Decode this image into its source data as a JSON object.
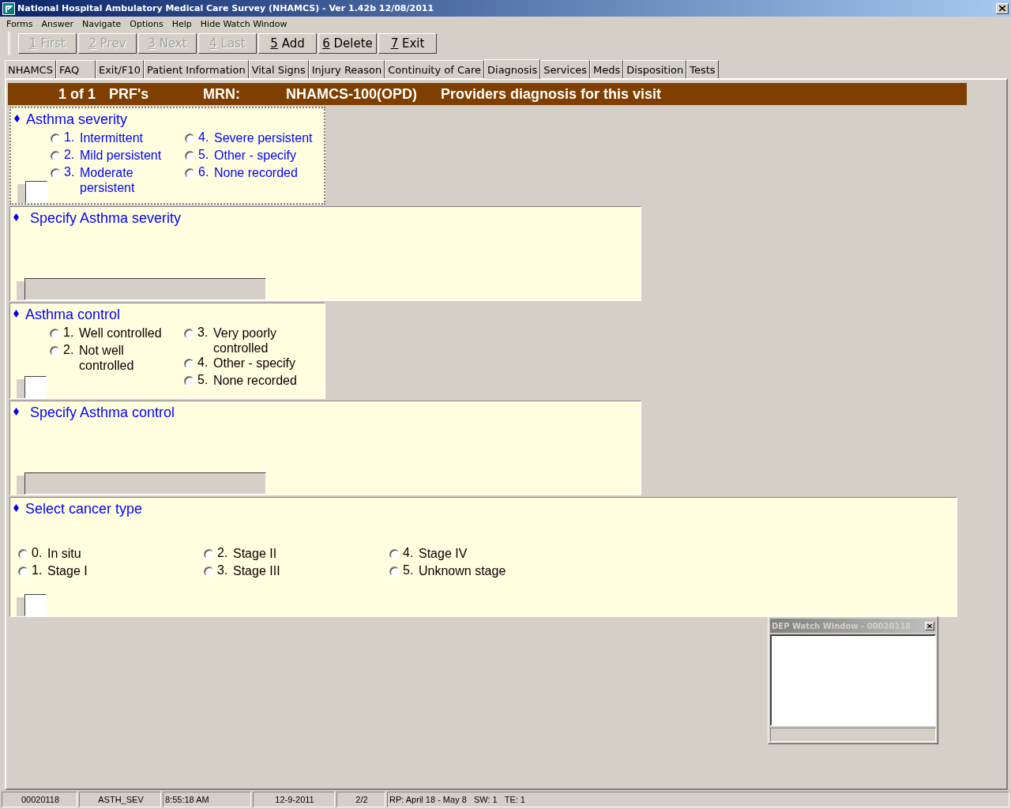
{
  "window": {
    "title": "National Hospital Ambulatory Medical Care Survey (NHAMCS) - Ver 1.42b 12/08/2011"
  },
  "menu": [
    "Forms",
    "Answer",
    "Navigate",
    "Options",
    "Help",
    "Hide Watch Window"
  ],
  "toolbar": [
    {
      "key": "1",
      "label": "First",
      "disabled": true
    },
    {
      "key": "2",
      "label": "Prev",
      "disabled": true
    },
    {
      "key": "3",
      "label": "Next",
      "disabled": true
    },
    {
      "key": "4",
      "label": "Last",
      "disabled": true
    },
    {
      "key": "5",
      "label": "Add",
      "disabled": false
    },
    {
      "key": "6",
      "label": "Delete",
      "disabled": false
    },
    {
      "key": "7",
      "label": "Exit",
      "disabled": false
    }
  ],
  "tabs": [
    {
      "label": "NHAMCS",
      "selected": false
    },
    {
      "label": "FAQ",
      "selected": false
    },
    {
      "label": "Exit/F10",
      "selected": false
    },
    {
      "label": "Patient Information",
      "selected": false
    },
    {
      "label": "Vital Signs",
      "selected": false
    },
    {
      "label": "Injury Reason",
      "selected": false
    },
    {
      "label": "Continuity of Care",
      "selected": false
    },
    {
      "label": "Diagnosis",
      "selected": true
    },
    {
      "label": "Services",
      "selected": false
    },
    {
      "label": "Meds",
      "selected": false
    },
    {
      "label": "Disposition",
      "selected": false
    },
    {
      "label": "Tests",
      "selected": false
    }
  ],
  "header": {
    "record": "1 of 1",
    "form": "PRF's",
    "mrn_label": "MRN:",
    "survey": "NHAMCS-100(OPD)",
    "title": "Providers diagnosis for this visit"
  },
  "questions": [
    {
      "kind": "radio",
      "title": "Asthma severity",
      "active": true,
      "columns": [
        [
          {
            "number": "1.",
            "label": "Intermittent",
            "selected": false
          },
          {
            "number": "2.",
            "label": "Mild persistent",
            "selected": false
          },
          {
            "number": "3.",
            "label": "Moderate\npersistent",
            "selected": false
          }
        ],
        [
          {
            "number": "4.",
            "label": "Severe persistent",
            "selected": false
          },
          {
            "number": "5.",
            "label": "Other - specify",
            "selected": false
          },
          {
            "number": "6.",
            "label": "None recorded",
            "selected": false
          }
        ]
      ]
    },
    {
      "kind": "text",
      "title": "Specify Asthma severity",
      "active": false
    },
    {
      "kind": "radio",
      "title": "Asthma control",
      "active": false,
      "columns": [
        [
          {
            "number": "1.",
            "label": "Well controlled",
            "selected": false
          },
          {
            "number": "2.",
            "label": "Not well\ncontrolled",
            "selected": false
          }
        ],
        [
          {
            "number": "3.",
            "label": "Very poorly\ncontrolled",
            "selected": false
          },
          {
            "number": "4.",
            "label": "Other - specify",
            "selected": false
          },
          {
            "number": "5.",
            "label": "None recorded",
            "selected": false
          }
        ]
      ]
    },
    {
      "kind": "text",
      "title": "Specify Asthma control",
      "active": false
    },
    {
      "kind": "radio",
      "title": "Select cancer type",
      "active": false,
      "columns": [
        [
          {
            "number": "0.",
            "label": "In situ",
            "selected": false
          },
          {
            "number": "1.",
            "label": "Stage I",
            "selected": false
          }
        ],
        [
          {
            "number": "2.",
            "label": "Stage II",
            "selected": false
          },
          {
            "number": "3.",
            "label": "Stage III",
            "selected": false
          }
        ],
        [
          {
            "number": "4.",
            "label": "Stage IV",
            "selected": false
          },
          {
            "number": "5.",
            "label": "Unknown stage",
            "selected": false
          }
        ]
      ]
    }
  ],
  "watch_window": {
    "title": "DEP Watch Window - 00020118"
  },
  "status_bar": [
    "00020118",
    "ASTH_SEV",
    "8:55:18 AM",
    "12-9-2011",
    "2/2",
    "RP: April 18 - May 8   SW: 1   TE: 1"
  ]
}
